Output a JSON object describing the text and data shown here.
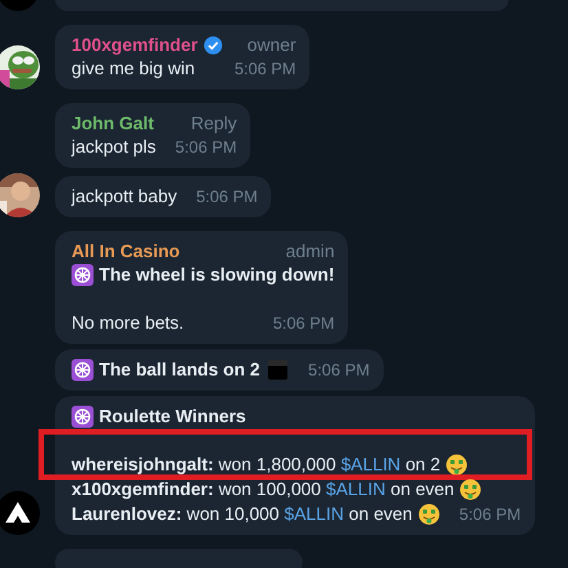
{
  "messages": [
    {
      "sender": "100xgemfinder",
      "color": "#e0518c",
      "verified": true,
      "role": "owner",
      "text": "give me big win",
      "time": "5:06 PM"
    },
    {
      "sender": "John Galt",
      "color": "#6dbb6a",
      "role": "Reply",
      "text": "jackpot pls",
      "time": "5:06 PM"
    },
    {
      "text": "jackpott baby",
      "time": "5:06 PM"
    },
    {
      "sender": "All In Casino",
      "color": "#e89a55",
      "role": "admin",
      "title_icon": {
        "kind": "wheel"
      },
      "title": "The wheel is slowing down!",
      "text": "No more bets.",
      "time": "5:06 PM"
    },
    {
      "title_icon": {
        "kind": "wheel"
      },
      "title": "The ball lands on 2",
      "title_trailing_icon": {
        "kind": "square"
      },
      "time": "5:06 PM"
    },
    {
      "avatar": {
        "kind": "logo"
      },
      "title_icon": {
        "kind": "wheel"
      },
      "title": "Roulette Winners",
      "winners": [
        {
          "user": "whereisjohngalt:",
          "text": "won 1,800,000",
          "tag": "$ALLIN",
          "rest": "on 2",
          "emoji": {
            "kind": "money-face"
          },
          "highlighted": true
        },
        {
          "user": "x100xgemfinder:",
          "text": "won 100,000",
          "tag": "$ALLIN",
          "rest": "on even",
          "emoji": {
            "kind": "money-face"
          },
          "highlighted": false
        },
        {
          "user": "Laurenlovez:",
          "text": "won 10,000",
          "tag": "$ALLIN",
          "rest": "on even",
          "emoji": {
            "kind": "money-face"
          },
          "highlighted": false
        }
      ],
      "time": "5:06 PM"
    }
  ]
}
